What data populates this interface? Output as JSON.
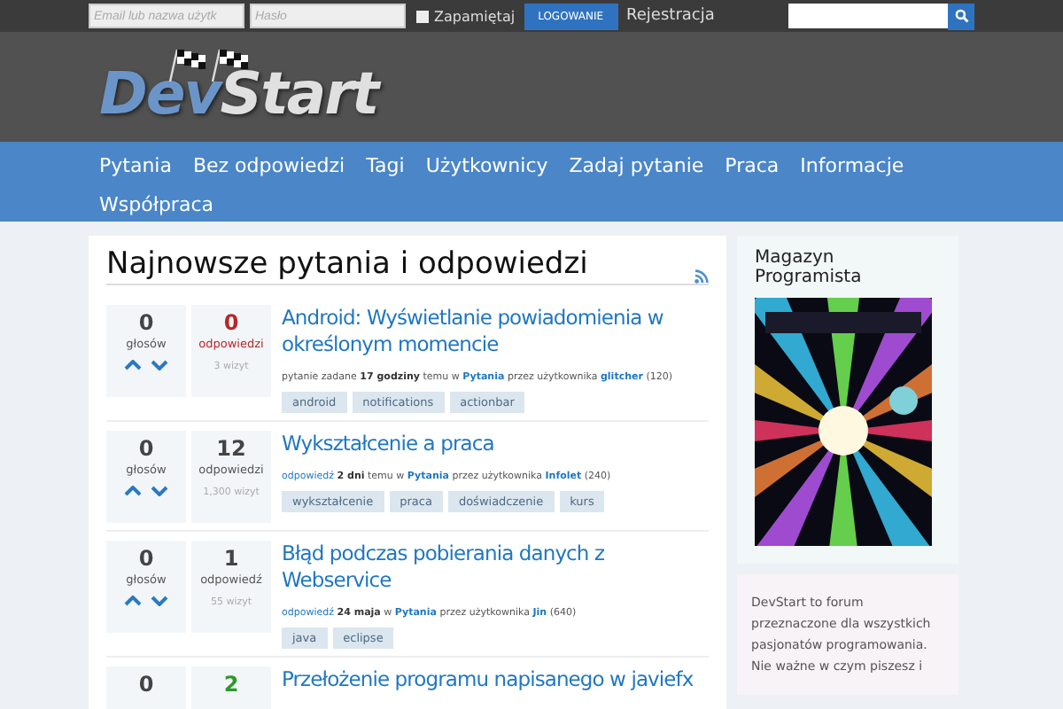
{
  "topbar": {
    "login_placeholder": "Email lub nazwa użytk",
    "password_placeholder": "Hasło",
    "remember": {
      "label": "Zapamiętaj",
      "checked": false
    },
    "login_button": "LOGOWANIE",
    "register_link": "Rejestracja"
  },
  "logo": {
    "part1": "Dev",
    "part2": "Start"
  },
  "nav": [
    "Pytania",
    "Bez odpowiedzi",
    "Tagi",
    "Użytkownicy",
    "Zadaj pytanie",
    "Praca",
    "Informacje",
    "Współpraca"
  ],
  "main": {
    "title": "Najnowsze pytania i odpowiedzi",
    "questions": [
      {
        "votes": "0",
        "votes_label": "głosów",
        "answers": "0",
        "answers_label": "odpowiedzi",
        "answered": false,
        "accepted": false,
        "views": "3 wizyt",
        "title": "Android: Wyświetlanie powiadomienia w określonym momencie",
        "meta": [
          {
            "text": "pytanie zadane",
            "kind": "plain"
          },
          {
            "text": "17 godziny",
            "kind": "bold"
          },
          {
            "text": "temu w",
            "kind": "plain"
          },
          {
            "text": "Pytania",
            "kind": "link"
          },
          {
            "text": "przez użytkownika",
            "kind": "plain"
          },
          {
            "text": "glitcher",
            "kind": "link"
          },
          {
            "text": "(120)",
            "kind": "plain"
          }
        ],
        "tags": [
          "android",
          "notifications",
          "actionbar"
        ]
      },
      {
        "votes": "0",
        "votes_label": "głosów",
        "answers": "12",
        "answers_label": "odpowiedzi",
        "answered": true,
        "accepted": false,
        "views": "1,300 wizyt",
        "title": "Wykształcenie a praca",
        "meta": [
          {
            "text": "odpowiedź",
            "kind": "action"
          },
          {
            "text": "2 dni",
            "kind": "bold"
          },
          {
            "text": "temu w",
            "kind": "plain"
          },
          {
            "text": "Pytania",
            "kind": "link"
          },
          {
            "text": "przez użytkownika",
            "kind": "plain"
          },
          {
            "text": "Infolet",
            "kind": "link"
          },
          {
            "text": "(240)",
            "kind": "plain"
          }
        ],
        "tags": [
          "wykształcenie",
          "praca",
          "doświadczenie",
          "kurs"
        ]
      },
      {
        "votes": "0",
        "votes_label": "głosów",
        "answers": "1",
        "answers_label": "odpowiedź",
        "answered": true,
        "accepted": false,
        "views": "55 wizyt",
        "title": "Błąd podczas pobierania danych z Webservice",
        "meta": [
          {
            "text": "odpowiedź",
            "kind": "action"
          },
          {
            "text": "24 maja",
            "kind": "bold"
          },
          {
            "text": "w",
            "kind": "plain"
          },
          {
            "text": "Pytania",
            "kind": "link"
          },
          {
            "text": "przez użytkownika",
            "kind": "plain"
          },
          {
            "text": "Jin",
            "kind": "link"
          },
          {
            "text": "(640)",
            "kind": "plain"
          }
        ],
        "tags": [
          "java",
          "eclipse"
        ]
      },
      {
        "votes": "0",
        "answers": "2",
        "answered": true,
        "accepted": true,
        "title": "Przełożenie programu napisanego w javiefx"
      }
    ]
  },
  "sidebar": {
    "magazine_title": "Magazyn Programista",
    "about": "DevStart to forum przeznaczone dla wszystkich pasjonatów programowania. Nie ważne w czym piszesz i"
  }
}
